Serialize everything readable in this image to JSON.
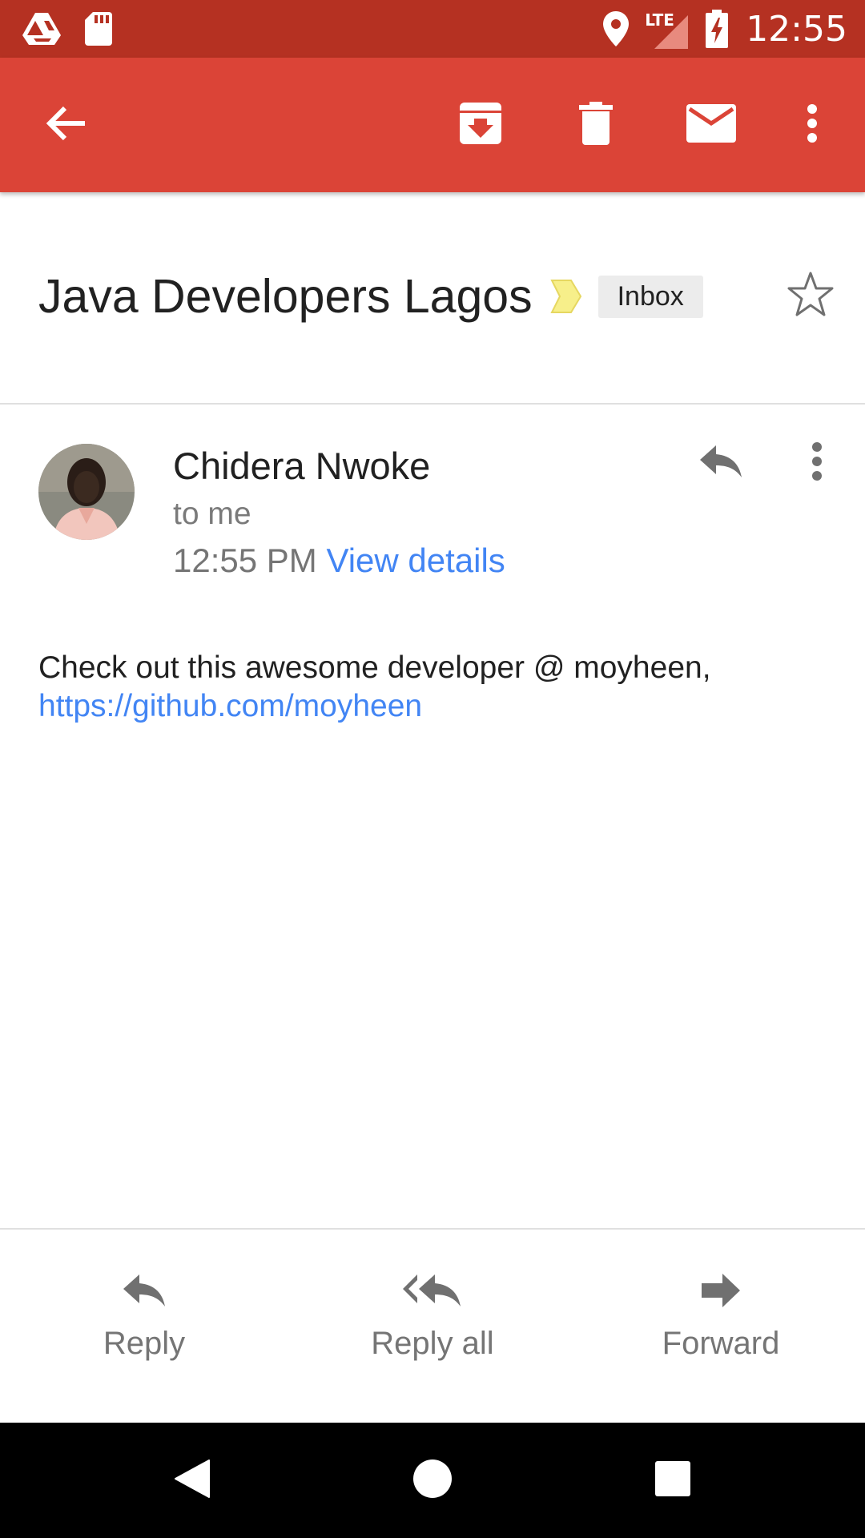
{
  "status_bar": {
    "time": "12:55",
    "network_label": "LTE",
    "icons": [
      "drive-icon",
      "sd-card-icon",
      "location-icon",
      "signal-icon",
      "battery-charging-icon"
    ]
  },
  "app_bar": {
    "actions": [
      "back-arrow-icon",
      "archive-icon",
      "delete-icon",
      "mark-unread-icon",
      "more-vert-icon"
    ]
  },
  "subject": {
    "title": "Java Developers Lagos",
    "label": "Inbox",
    "importance_color": "#f7ef8a"
  },
  "message": {
    "sender": "Chidera Nwoke",
    "recipient": "to me",
    "time": "12:55 PM",
    "details_link": "View details",
    "body_text": "Check out this awesome developer @ moyheen,",
    "body_link": "https://github.com/moyheen"
  },
  "actions": {
    "reply": "Reply",
    "reply_all": "Reply all",
    "forward": "Forward"
  },
  "colors": {
    "status_bar": "#b53122",
    "app_bar": "#db4437",
    "link": "#4285f4",
    "secondary_text": "#757575"
  }
}
